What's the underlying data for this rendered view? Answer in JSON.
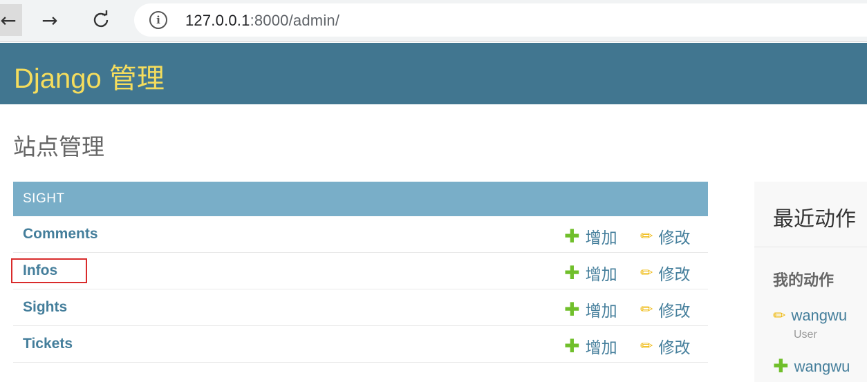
{
  "browser": {
    "back_icon": "arrow-left-icon",
    "forward_icon": "arrow-right-icon",
    "reload_icon": "reload-icon",
    "info_icon": "info-icon",
    "url_host": "127.0.0.1",
    "url_rest": ":8000/admin/"
  },
  "header": {
    "branding": "Django 管理"
  },
  "page": {
    "title": "站点管理"
  },
  "app": {
    "caption": "SIGHT",
    "models": [
      {
        "name": "Comments",
        "add": "增加",
        "change": "修改"
      },
      {
        "name": "Infos",
        "add": "增加",
        "change": "修改"
      },
      {
        "name": "Sights",
        "add": "增加",
        "change": "修改"
      },
      {
        "name": "Tickets",
        "add": "增加",
        "change": "修改"
      }
    ]
  },
  "recent": {
    "title": "最近动作",
    "my_actions": "我的动作",
    "items": [
      {
        "icon": "pencil-icon",
        "label": "wangwu",
        "type": "User"
      },
      {
        "icon": "plus-icon",
        "label": "wangwu"
      }
    ]
  },
  "colors": {
    "header_bg": "#417690",
    "branding": "#f5dd5d",
    "caption_bg": "#79aec8",
    "link": "#447e9b",
    "add_icon": "#70bf2b",
    "change_icon": "#efb80b",
    "highlight": "#d92b2b"
  }
}
